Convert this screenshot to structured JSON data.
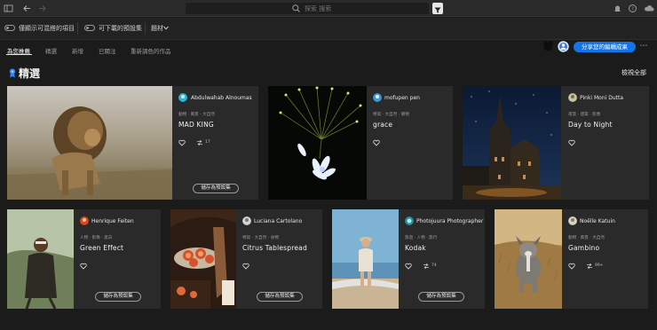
{
  "search": {
    "placeholder": "探索 搜索"
  },
  "filters": [
    {
      "label": "僅顯示可混搭的項目"
    },
    {
      "label": "可下載的預設集"
    },
    {
      "label": "題材"
    }
  ],
  "tabs": [
    {
      "label": "為您推薦",
      "active": true
    },
    {
      "label": "精選"
    },
    {
      "label": "新增"
    },
    {
      "label": "已關注"
    },
    {
      "label": "重新調色的作品"
    }
  ],
  "share_button": "分享您的編輯成果",
  "section": {
    "title": "精選",
    "view_all": "檢視全部"
  },
  "accent_color": "#1473e6",
  "save_label": "儲存為預設集",
  "cards": [
    {
      "author": "Abdulwahab Alnoumas",
      "tags": "動物 · 風景 · 大自然",
      "title": "MAD KING",
      "remix_count": "17"
    },
    {
      "author": "mofupen pen",
      "tags": "特寫 · 大自然 · 靜物",
      "title": "grace"
    },
    {
      "author": "Pinki Moni Dutta",
      "tags": "夜景 · 建築 · 影像",
      "title": "Day to Night"
    },
    {
      "author": "Henrique Feiten",
      "tags": "人物 · 影像 · 黑白",
      "title": "Green Effect"
    },
    {
      "author": "Luciana Cartolano",
      "tags": "特寫 · 大自然 · 食物",
      "title": "Citrus Tablespread"
    },
    {
      "author": "Photojuura Photographer",
      "tags": "旅遊 · 人物 · 旅行",
      "title": "Kodak",
      "remix_count": "74"
    },
    {
      "author": "Noëlle Katuin",
      "tags": "動物 · 風景 · 大自然",
      "title": "Gambino",
      "remix_count": "99+"
    }
  ]
}
